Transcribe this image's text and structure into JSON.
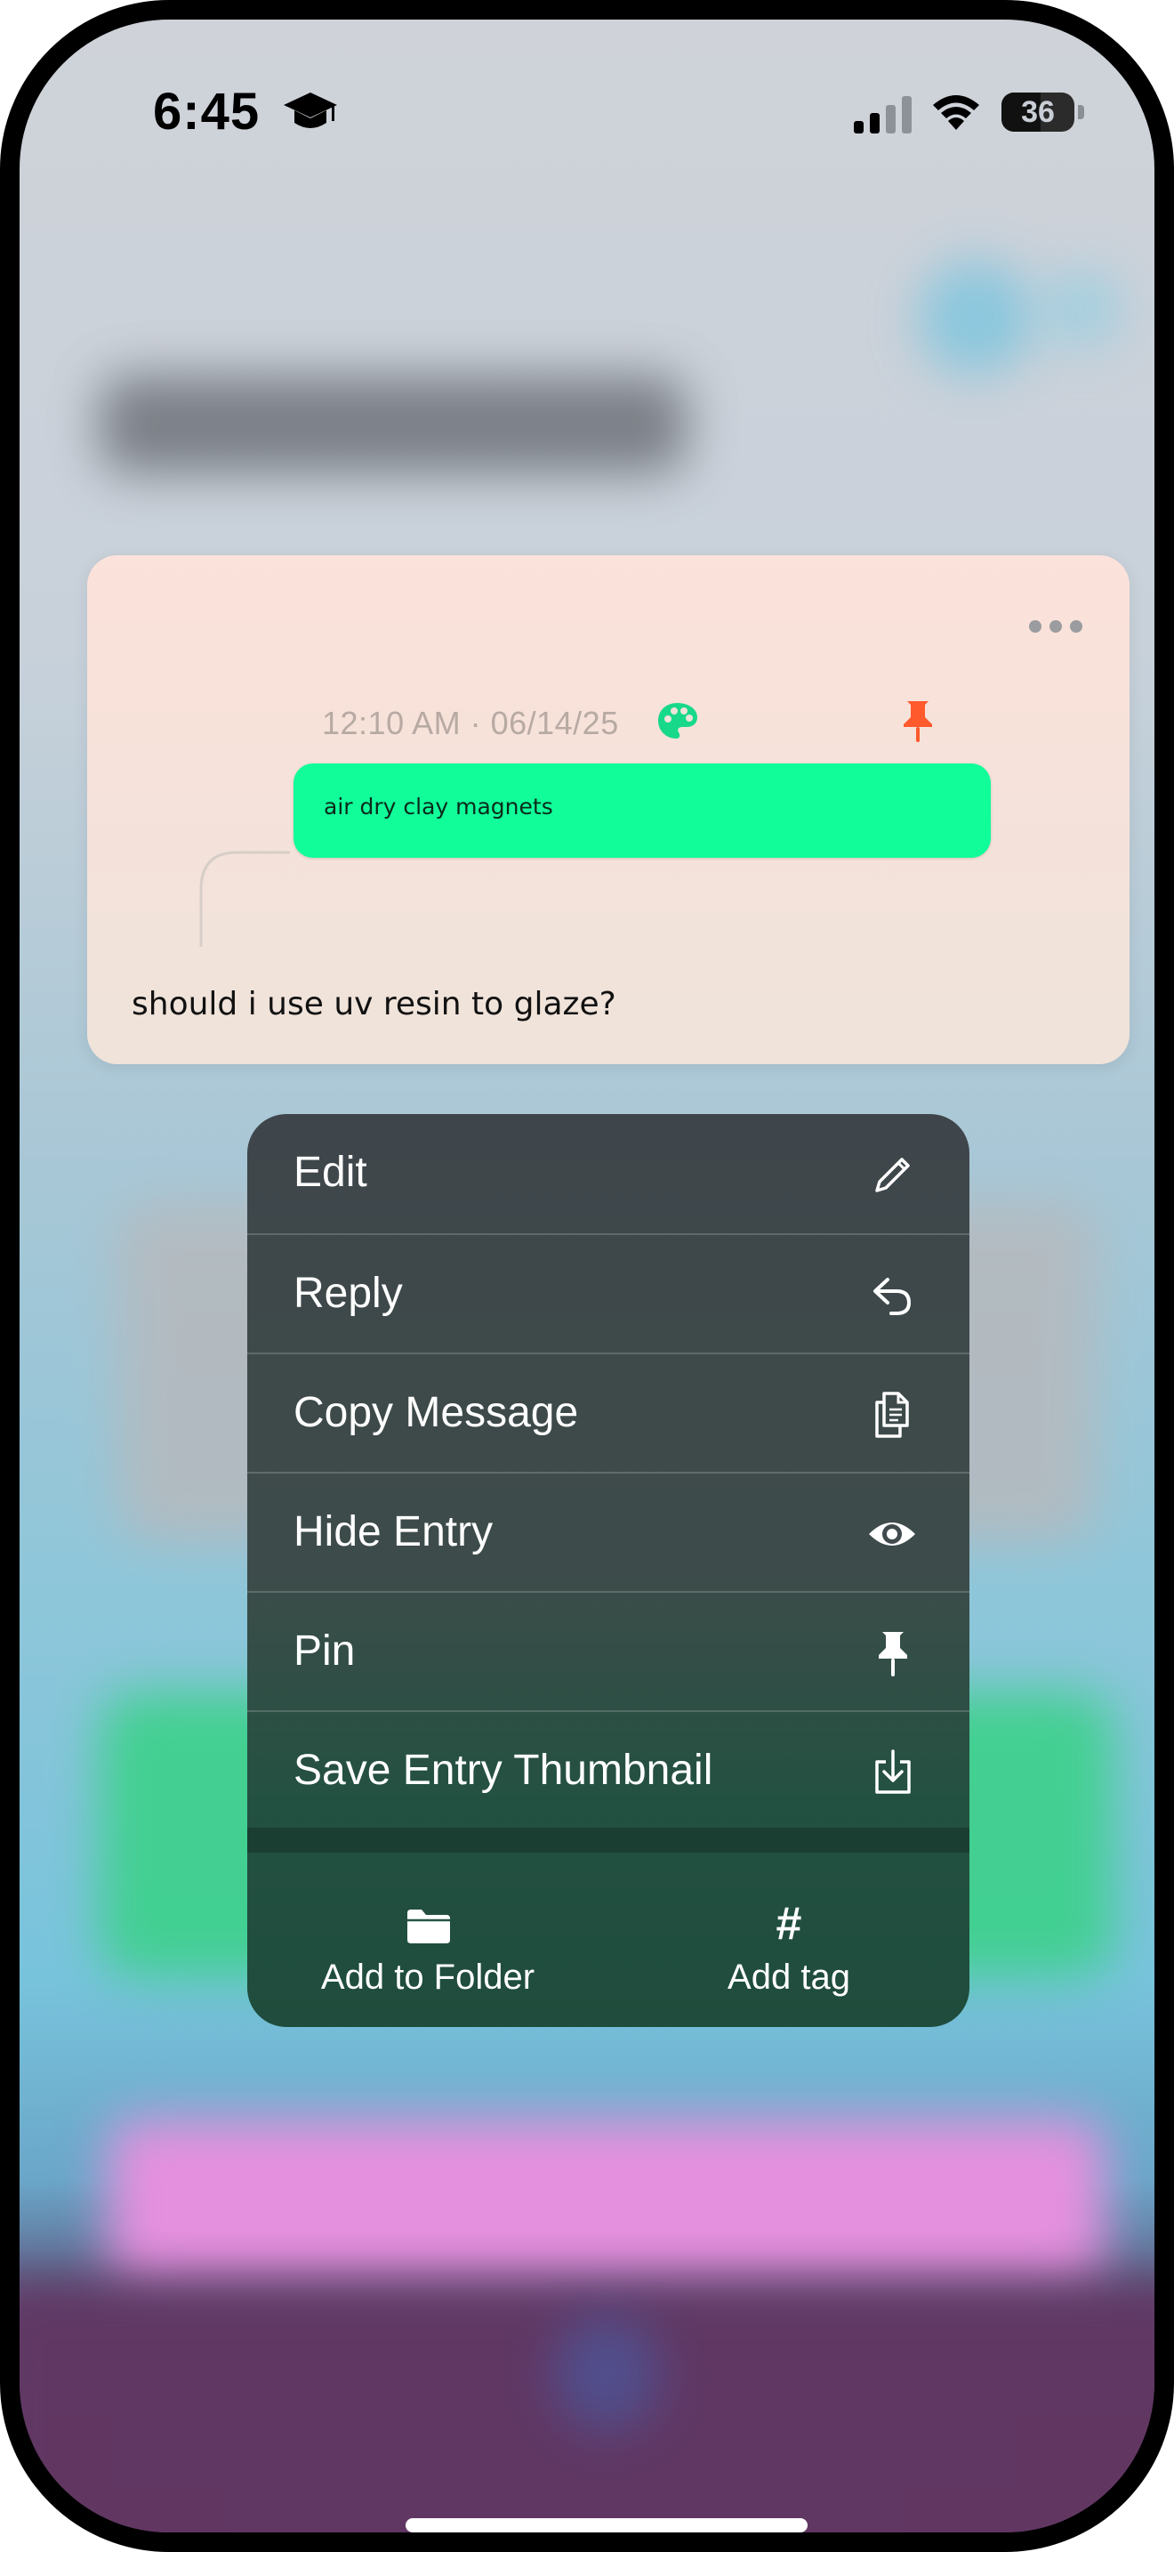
{
  "status_bar": {
    "time": "6:45",
    "battery": "36"
  },
  "entry": {
    "timestamp": "12:10 AM · 06/14/25",
    "quoted_message": "air dry clay magnets",
    "message": "should i use uv resin to glaze?",
    "quote_color": "#11fd9a",
    "pin_color": "#ff5a2c",
    "palette_color": "#18d98a"
  },
  "context_menu": {
    "items": [
      {
        "label": "Edit",
        "icon": "pencil-icon"
      },
      {
        "label": "Reply",
        "icon": "reply-arrow-icon"
      },
      {
        "label": "Copy Message",
        "icon": "copy-icon"
      },
      {
        "label": "Hide Entry",
        "icon": "eye-icon"
      },
      {
        "label": "Pin",
        "icon": "pin-icon"
      },
      {
        "label": "Save Entry Thumbnail",
        "icon": "save-download-icon"
      }
    ],
    "bottom_actions": [
      {
        "label": "Add to Folder",
        "icon": "folder-icon"
      },
      {
        "label": "Add tag",
        "icon": "hash-icon",
        "glyph": "#"
      }
    ]
  }
}
